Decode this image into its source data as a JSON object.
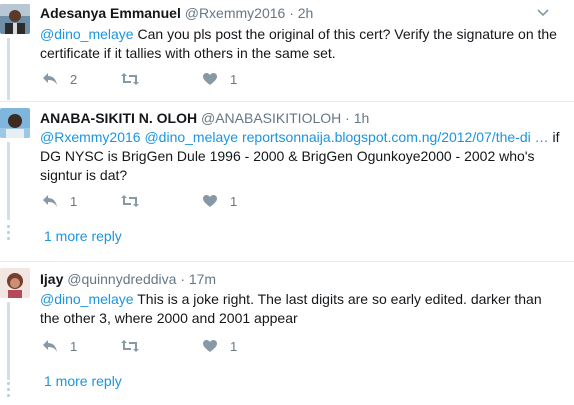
{
  "replies": [
    {
      "name": "Adesanya Emmanuel",
      "handle": "@Rxemmy2016",
      "time": "· 2h",
      "text_parts": [
        {
          "t": "@dino_melaye",
          "link": true
        },
        {
          "t": " Can you pls post the original of this cert? Verify the signature on the certificate if it tallies with others in the same set.",
          "link": false
        }
      ],
      "reply_count": "2",
      "retweet_count": "",
      "like_count": "1"
    },
    {
      "name": "ANABA-SIKITI N. OLOH",
      "handle": "@ANABASIKITIOLOH",
      "time": "· 1h",
      "text_parts": [
        {
          "t": "@Rxemmy2016",
          "link": true
        },
        {
          "t": " ",
          "link": false
        },
        {
          "t": "@dino_melaye",
          "link": true
        },
        {
          "t": " ",
          "link": false
        },
        {
          "t": "reportsonnaija.blogspot.com.ng/2012/07/the-di",
          "link": true
        },
        {
          "t": " ",
          "link": false
        },
        {
          "t": "…",
          "link": true
        },
        {
          "t": " if DG NYSC is BrigGen Dule 1996 - 2000 & BrigGen Ogunkoye2000 - 2002 who's signtur is dat?",
          "link": false
        }
      ],
      "reply_count": "1",
      "retweet_count": "",
      "like_count": "1",
      "more_replies": "1 more reply"
    },
    {
      "name": "Ijay",
      "handle": "@quinnydreddiva",
      "time": "· 17m",
      "text_parts": [
        {
          "t": "@dino_melaye",
          "link": true
        },
        {
          "t": " This is a joke right. The last digits are so early edited. darker than the other 3, where 2000 and 2001 appear",
          "link": false
        }
      ],
      "reply_count": "1",
      "retweet_count": "",
      "like_count": "1",
      "more_replies": "1 more reply"
    }
  ],
  "colors": {
    "link": "#1b95e0",
    "muted": "#657786",
    "icon": "#8899a6",
    "thread_line": "#cfe0ea"
  },
  "icons": {
    "reply": "reply-icon",
    "retweet": "retweet-icon",
    "like": "heart-icon",
    "more": "chevron-down-icon"
  }
}
